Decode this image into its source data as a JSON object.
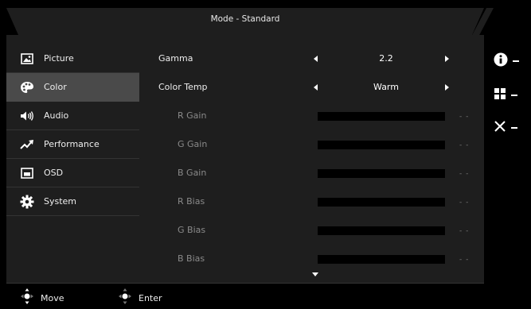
{
  "header": {
    "title": "Mode - Standard"
  },
  "sidebar": {
    "items": [
      {
        "label": "Picture",
        "icon": "picture-icon",
        "active": false
      },
      {
        "label": "Color",
        "icon": "palette-icon",
        "active": true
      },
      {
        "label": "Audio",
        "icon": "speaker-icon",
        "active": false
      },
      {
        "label": "Performance",
        "icon": "trend-icon",
        "active": false
      },
      {
        "label": "OSD",
        "icon": "osd-window-icon",
        "active": false
      },
      {
        "label": "System",
        "icon": "gear-icon",
        "active": false
      }
    ]
  },
  "settings": {
    "gamma": {
      "label": "Gamma",
      "value": "2.2"
    },
    "color_temp": {
      "label": "Color Temp",
      "value": "Warm"
    },
    "r_gain": {
      "label": "R Gain",
      "value": "- -"
    },
    "g_gain": {
      "label": "G Gain",
      "value": "- -"
    },
    "b_gain": {
      "label": "B Gain",
      "value": "- -"
    },
    "r_bias": {
      "label": "R Bias",
      "value": "- -"
    },
    "g_bias": {
      "label": "G Bias",
      "value": "- -"
    },
    "b_bias": {
      "label": "B Bias",
      "value": "- -"
    }
  },
  "footer": {
    "move_label": "Move",
    "enter_label": "Enter"
  },
  "right_buttons": [
    "info-icon",
    "menu-grid-icon",
    "close-icon"
  ],
  "colors": {
    "panel": "#1e1e1e",
    "active_item": "#4a4a4a",
    "background": "#000000"
  }
}
